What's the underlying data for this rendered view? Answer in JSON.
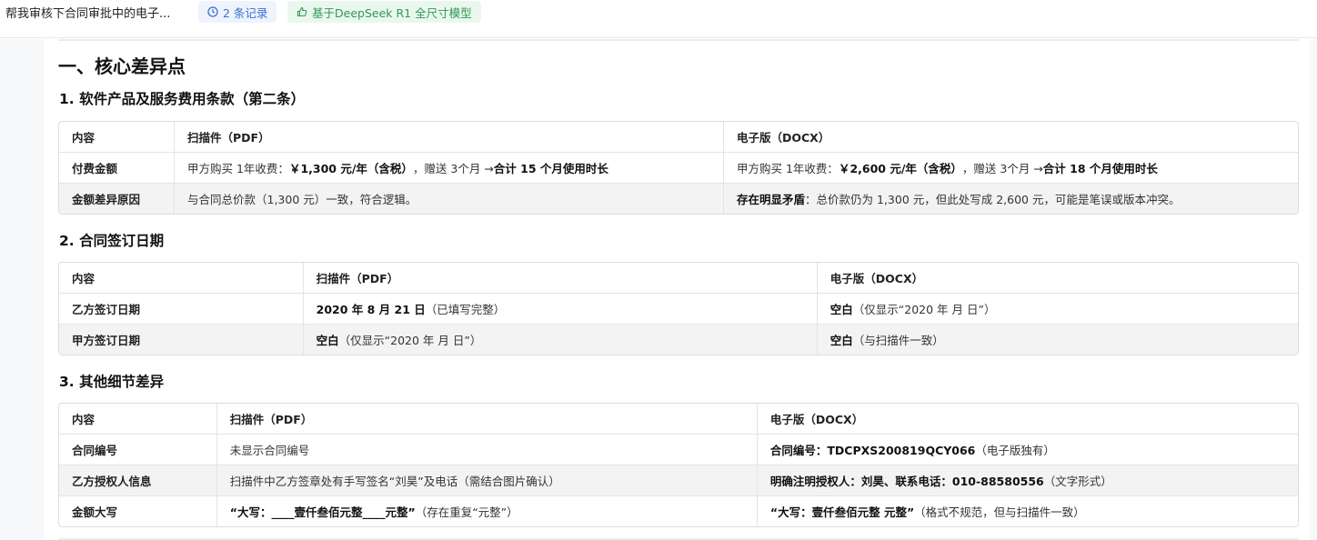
{
  "topbar": {
    "title": "帮我审核下合同审批中的电子...",
    "records_label": "2 条记录",
    "model_label": "基于DeepSeek R1 全尺寸模型"
  },
  "heading": "一、核心差异点",
  "sections": [
    {
      "title": "1. 软件产品及服务费用条款（第二条）",
      "headers": [
        "内容",
        "扫描件（PDF）",
        "电子版（DOCX）"
      ],
      "rows": [
        {
          "label": "付费金额",
          "pdf": [
            {
              "t": "甲方购买 1年收费："
            },
            {
              "t": "￥1,300 元/年（含税）",
              "b": true
            },
            {
              "t": "，赠送 3个月 → "
            },
            {
              "t": "合计 15 个月使用时长",
              "b": true
            }
          ],
          "docx": [
            {
              "t": "甲方购买 1年收费："
            },
            {
              "t": "￥2,600 元/年（含税）",
              "b": true
            },
            {
              "t": "，赠送 3个月 → "
            },
            {
              "t": "合计 18 个月使用时长",
              "b": true
            }
          ]
        },
        {
          "label": "金额差异原因",
          "pdf": [
            {
              "t": "与合同总价款（1,300 元）一致，符合逻辑。"
            }
          ],
          "docx": [
            {
              "t": "存在明显矛盾",
              "b": true
            },
            {
              "t": "：总价款仍为 1,300 元，但此处写成 2,600 元，可能是笔误或版本冲突。"
            }
          ]
        }
      ]
    },
    {
      "title": "2. 合同签订日期",
      "headers": [
        "内容",
        "扫描件（PDF）",
        "电子版（DOCX）"
      ],
      "rows": [
        {
          "label": "乙方签订日期",
          "pdf": [
            {
              "t": "2020 年 8 月 21 日",
              "b": true
            },
            {
              "t": "（已填写完整）"
            }
          ],
          "docx": [
            {
              "t": "空白",
              "b": true
            },
            {
              "t": "（仅显示“2020 年 月 日”）"
            }
          ]
        },
        {
          "label": "甲方签订日期",
          "pdf": [
            {
              "t": "空白",
              "b": true
            },
            {
              "t": "（仅显示“2020 年 月 日”）"
            }
          ],
          "docx": [
            {
              "t": "空白",
              "b": true
            },
            {
              "t": "（与扫描件一致）"
            }
          ]
        }
      ]
    },
    {
      "title": "3. 其他细节差异",
      "headers": [
        "内容",
        "扫描件（PDF）",
        "电子版（DOCX）"
      ],
      "rows": [
        {
          "label": "合同编号",
          "pdf": [
            {
              "t": "未显示合同编号"
            }
          ],
          "docx": [
            {
              "t": "合同编号：TDCPXS200819QCY066",
              "b": true
            },
            {
              "t": "（电子版独有）"
            }
          ]
        },
        {
          "label": "乙方授权人信息",
          "pdf": [
            {
              "t": "扫描件中乙方签章处有手写签名“刘昊”及电话（需结合图片确认）"
            }
          ],
          "docx": [
            {
              "t": "明确注明授权人：刘昊、联系电话：010-88580556",
              "b": true
            },
            {
              "t": "（文字形式）"
            }
          ]
        },
        {
          "label": "金额大写",
          "pdf": [
            {
              "t": "“大写：____壹仟叁佰元整____元整”",
              "b": true
            },
            {
              "t": "（存在重复“元整”）"
            }
          ],
          "docx": [
            {
              "t": "“大写：壹仟叁佰元整 元整”",
              "b": true
            },
            {
              "t": "（格式不规范，但与扫描件一致）"
            }
          ]
        }
      ]
    }
  ]
}
